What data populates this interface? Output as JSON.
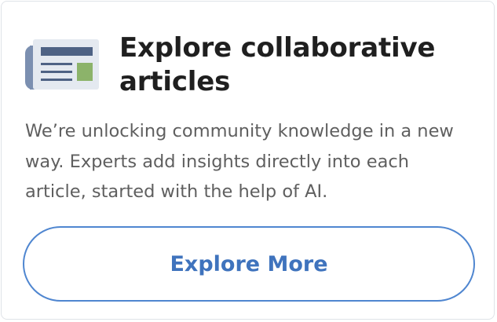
{
  "card": {
    "icon": "newspaper-icon",
    "title": "Explore collaborative articles",
    "description": "We’re unlocking community knowledge in a new way. Experts add insights directly into each article, started with the help of AI.",
    "button_label": "Explore More",
    "colors": {
      "title": "#1f1f1f",
      "description": "#5f5f5f",
      "button_border": "#4f86d0",
      "button_text": "#3f73bd",
      "icon_dark": "#5a6e8f",
      "icon_light": "#cfd7e2",
      "icon_accent": "#8cb36a"
    }
  }
}
